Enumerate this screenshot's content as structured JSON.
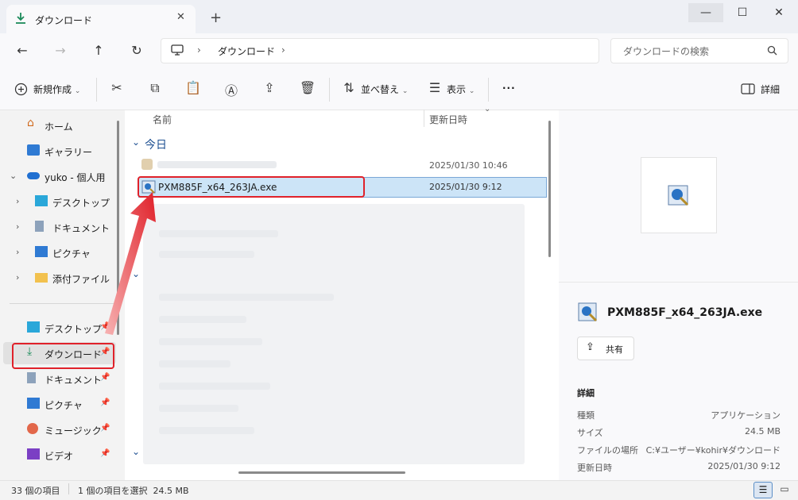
{
  "window": {
    "tab_title": "ダウンロード",
    "close_tab": "✕",
    "new_tab": "+",
    "minimize": "—",
    "maximize": "☐",
    "close": "✕"
  },
  "nav": {
    "back": "←",
    "forward": "→",
    "up": "↑",
    "refresh": "↻",
    "breadcrumb": [
      "ダウンロード"
    ],
    "search_placeholder": "ダウンロードの検索"
  },
  "toolbar": {
    "new_label": "新規作成",
    "sort_label": "並べ替え",
    "view_label": "表示",
    "more_label": "···",
    "details_label": "詳細"
  },
  "sidebar": {
    "items": [
      {
        "label": "ホーム"
      },
      {
        "label": "ギャラリー"
      },
      {
        "label": "yuko - 個人用"
      },
      {
        "label": "デスクトップ"
      },
      {
        "label": "ドキュメント"
      },
      {
        "label": "ピクチャ"
      },
      {
        "label": "添付ファイル"
      },
      {
        "label": "デスクトップ"
      },
      {
        "label": "ダウンロード"
      },
      {
        "label": "ドキュメント"
      },
      {
        "label": "ピクチャ"
      },
      {
        "label": "ミュージック"
      },
      {
        "label": "ビデオ"
      }
    ]
  },
  "files": {
    "col_name": "名前",
    "col_modified": "更新日時",
    "group_today": "今日",
    "rows": [
      {
        "date": "2025/01/30 10:46"
      },
      {
        "name": "PXM885F_x64_263JA.exe",
        "date": "2025/01/30 9:12"
      }
    ]
  },
  "preview": {
    "file_name": "PXM885F_x64_263JA.exe",
    "share_label": "共有",
    "details_heading": "詳細",
    "fields": [
      {
        "key": "種類",
        "value": "アプリケーション"
      },
      {
        "key": "サイズ",
        "value": "24.5 MB"
      },
      {
        "key": "ファイルの場所",
        "value": "C:¥ユーザー¥kohir¥ダウンロード"
      },
      {
        "key": "更新日時",
        "value": "2025/01/30 9:12"
      }
    ]
  },
  "status": {
    "count": "33 個の項目",
    "selection": "1 個の項目を選択  24.5 MB"
  },
  "colors": {
    "accent": "#0067c0",
    "highlight_red": "#e0212a",
    "selection": "#cce4f7"
  }
}
